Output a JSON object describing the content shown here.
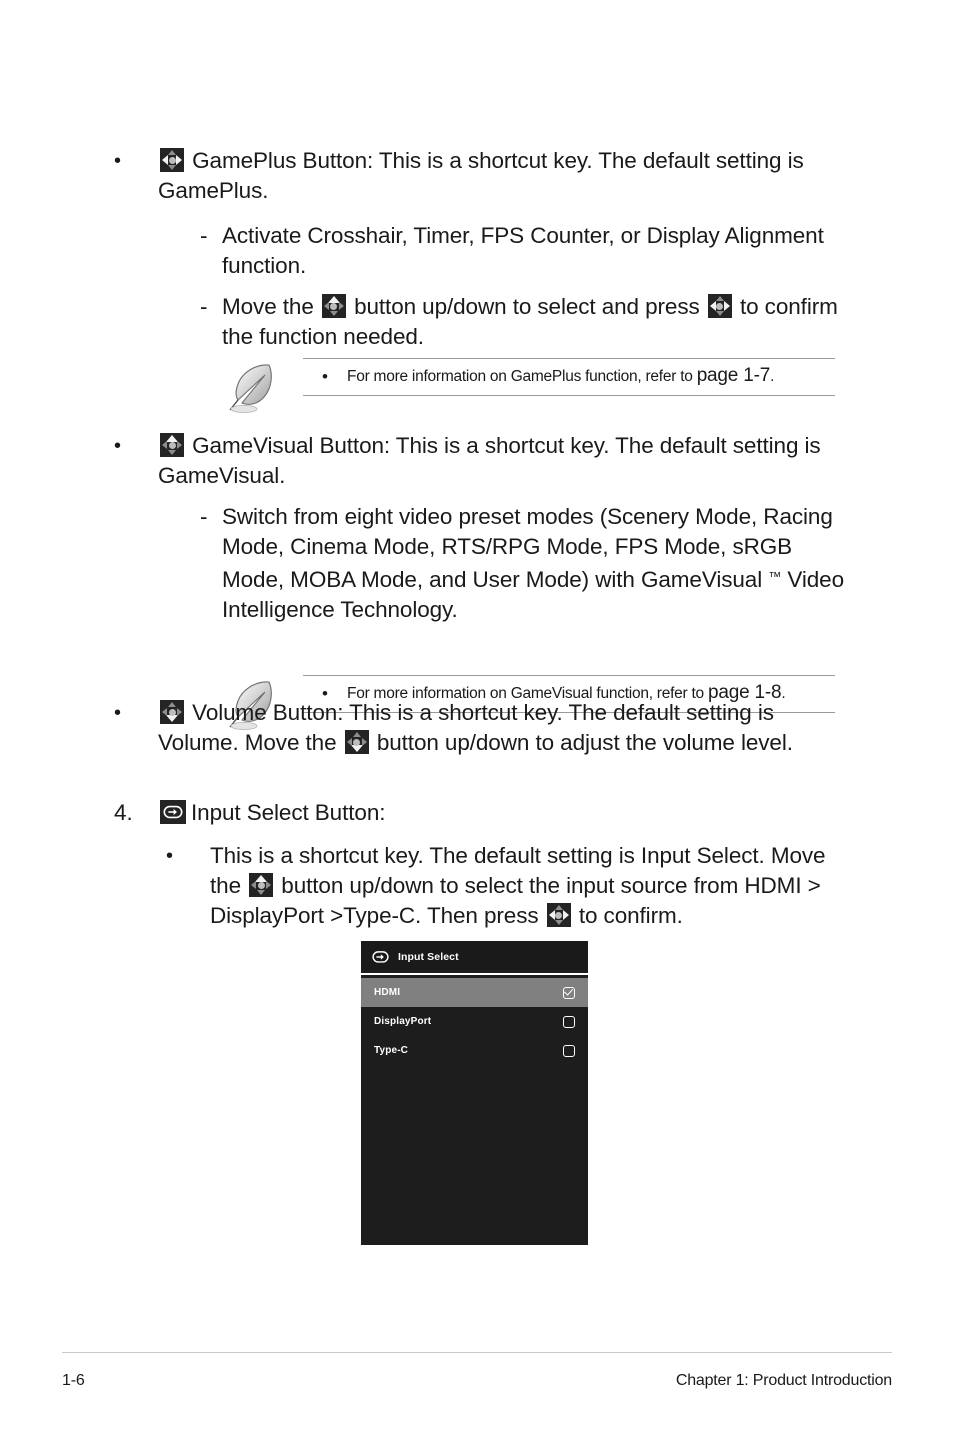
{
  "page": {
    "number": "1-6",
    "chapter": "Chapter 1: Product Introduction"
  },
  "sections": {
    "gameplus": {
      "bullet": "•",
      "icon": "nav-key-left-right-icon",
      "text": "GamePlus Button: This is a shortcut key. The default setting is GamePlus.",
      "sub1_dash": "-",
      "sub1": "Activate Crosshair, Timer, FPS Counter, or Display Alignment function.",
      "sub2_dash": "-",
      "sub2_part1": "Move the",
      "sub2_part2": "button up/down to select and press",
      "sub2_part3": "to confirm the function needed."
    },
    "note1": {
      "icon": "quill-pen-icon",
      "bullet": "•",
      "text": "For more information on GamePlus function, refer to ",
      "pageref": "page 1-7",
      "suffix": "."
    },
    "gamevisual": {
      "bullet": "•",
      "icon": "nav-key-up-icon",
      "text": "GameVisual Button: This is a shortcut key. The default setting is GameVisual.",
      "sub_dash": "-",
      "sub_part1": "Switch from eight video preset modes (Scenery Mode, Racing Mode, Cinema Mode, RTS/RPG Mode, FPS Mode, sRGB Mode, MOBA Mode, and User Mode) with GameVisual ",
      "sub_tm": "™",
      "sub_part2": " Video Intelligence Technology."
    },
    "note2": {
      "icon": "quill-pen-icon",
      "bullet": "•",
      "text": "For more information on GameVisual function, refer to ",
      "pageref": "page 1-8",
      "suffix": "."
    },
    "volume": {
      "bullet": "•",
      "icon": "nav-key-down-icon",
      "text_part1": "Volume Button: This is a shortcut key. The default setting is Volume. Move the",
      "text_part2": "button up/down to adjust the volume level."
    },
    "item4": {
      "number": "4.",
      "icon": "input-select-key-icon",
      "title": "Input Select Button:",
      "bullet": "•",
      "sub_part1": "This is a shortcut key. The default setting is Input Select. Move the",
      "sub_part2": "button up/down to select the input source from HDMI > DisplayPort >Type-C. Then press",
      "sub_part3": "to confirm."
    }
  },
  "osd": {
    "header_icon": "input-select-icon",
    "title": "Input Select",
    "rows": [
      {
        "label": "HDMI",
        "selected": true,
        "checked": true
      },
      {
        "label": "DisplayPort",
        "selected": false,
        "checked": false
      },
      {
        "label": "Type-C",
        "selected": false,
        "checked": false
      }
    ],
    "colors": {
      "background": "#1d1d1d",
      "header_bg": "#1a1a1a",
      "highlight": "#808080",
      "text": "#ffffff"
    }
  }
}
